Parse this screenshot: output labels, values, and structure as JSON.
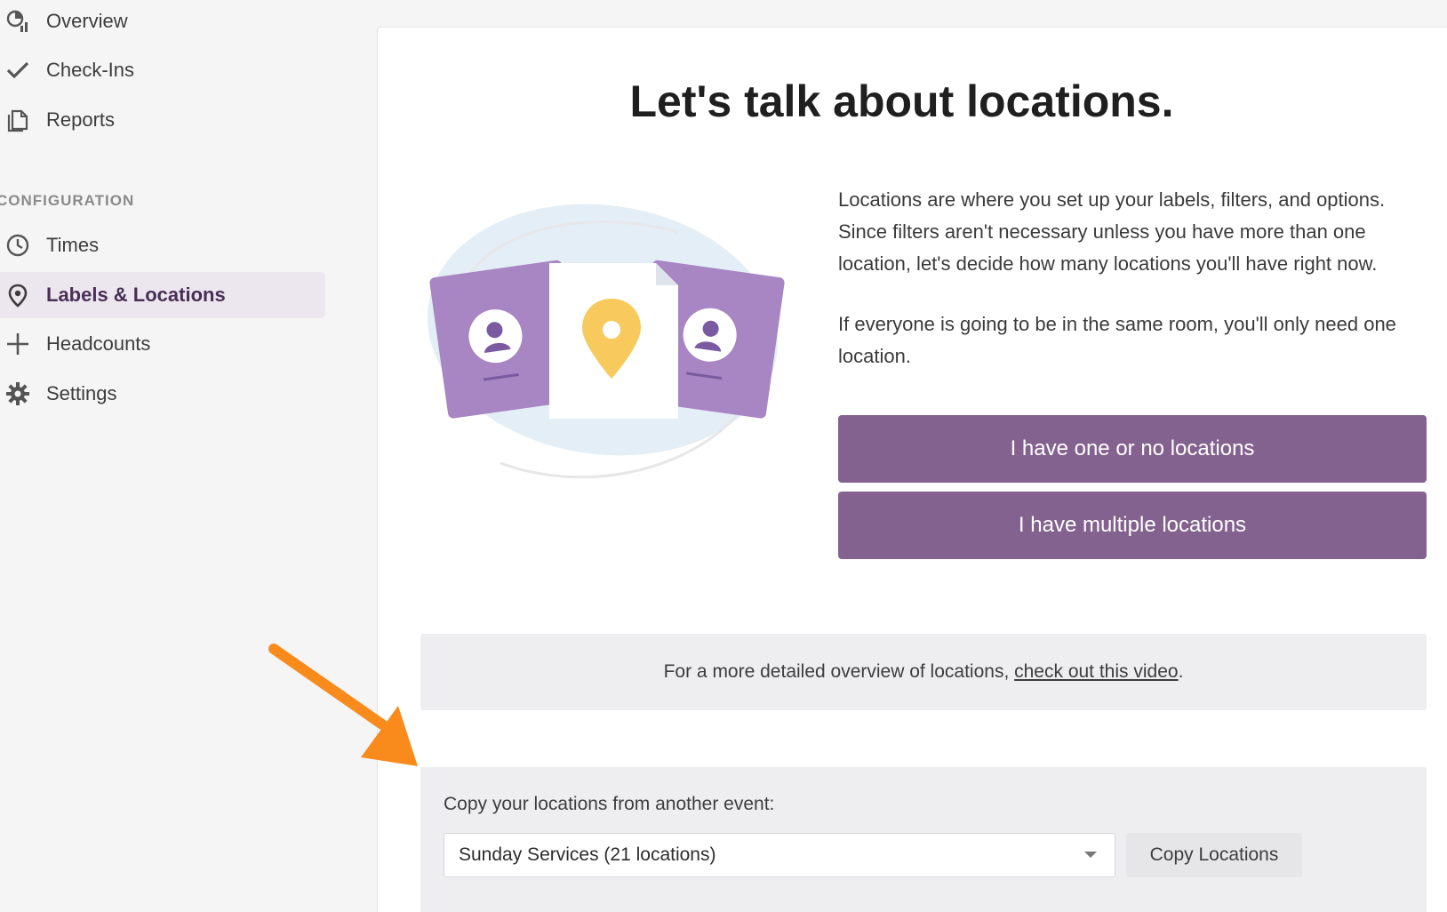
{
  "sidebar": {
    "items": [
      {
        "label": "Overview",
        "icon": "overview-chart-icon"
      },
      {
        "label": "Check-Ins",
        "icon": "checkmark-icon"
      },
      {
        "label": "Reports",
        "icon": "reports-document-icon"
      }
    ],
    "section_label": "CONFIGURATION",
    "config_items": [
      {
        "label": "Times",
        "icon": "clock-icon"
      },
      {
        "label": "Labels & Locations",
        "icon": "location-pin-icon",
        "active": true
      },
      {
        "label": "Headcounts",
        "icon": "plus-icon"
      },
      {
        "label": "Settings",
        "icon": "gear-icon"
      }
    ]
  },
  "main": {
    "title": "Let's talk about locations.",
    "paragraph_1": "Locations are where you set up your labels, filters, and options. Since filters aren't necessary unless you have more than one location, let's decide how many locations you'll have right now.",
    "paragraph_2": "If everyone is going to be in the same room, you'll only need one location.",
    "button_one": "I have one or no locations",
    "button_multiple": "I have multiple locations",
    "info_text": "For a more detailed overview of locations, ",
    "info_link": "check out this video",
    "info_suffix": ".",
    "copy_label": "Copy your locations from another event:",
    "copy_select_value": "Sunday Services (21 locations)",
    "copy_button": "Copy Locations"
  },
  "colors": {
    "accent": "#84628f",
    "active_nav_bg": "#ece6ef",
    "annotation_arrow": "#f98a1c"
  }
}
